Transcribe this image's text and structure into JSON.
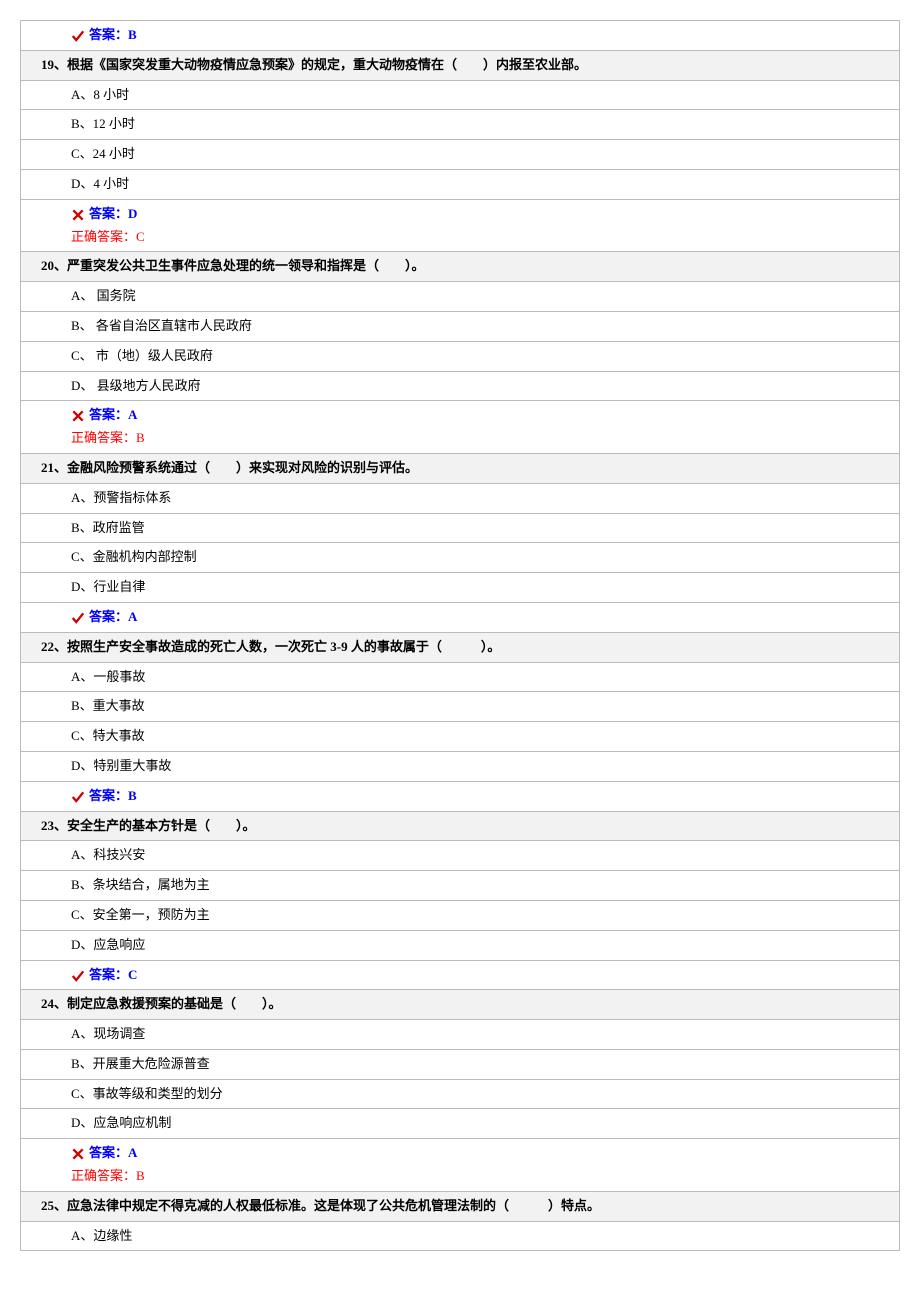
{
  "answer_prefix": "答案：",
  "correct_prefix": "正确答案：",
  "questions": [
    {
      "number": "",
      "text": "",
      "options": [],
      "user_answer": "B",
      "is_correct": true,
      "correct_answer": null
    },
    {
      "number": "19、",
      "text": "根据《国家突发重大动物疫情应急预案》的规定，重大动物疫情在（　　）内报至农业部。",
      "options": [
        "A、8 小时",
        "B、12 小时",
        "C、24 小时",
        "D、4 小时"
      ],
      "user_answer": "D",
      "is_correct": false,
      "correct_answer": "C"
    },
    {
      "number": "20、",
      "text": "严重突发公共卫生事件应急处理的统一领导和指挥是（　　）。",
      "options": [
        "A、 国务院",
        "B、 各省自治区直辖市人民政府",
        "C、 市（地）级人民政府",
        "D、 县级地方人民政府"
      ],
      "user_answer": "A",
      "is_correct": false,
      "correct_answer": "B"
    },
    {
      "number": "21、",
      "text": "金融风险预警系统通过（　　）来实现对风险的识别与评估。",
      "options": [
        "A、预警指标体系",
        "B、政府监管",
        "C、金融机构内部控制",
        "D、行业自律"
      ],
      "user_answer": "A",
      "is_correct": true,
      "correct_answer": null
    },
    {
      "number": "22、",
      "text": "按照生产安全事故造成的死亡人数，一次死亡 3-9 人的事故属于（　　　）。",
      "options": [
        "A、一般事故",
        "B、重大事故",
        "C、特大事故",
        "D、特别重大事故"
      ],
      "user_answer": "B",
      "is_correct": true,
      "correct_answer": null
    },
    {
      "number": "23、",
      "text": "安全生产的基本方针是（　　）。",
      "options": [
        "A、科技兴安",
        "B、条块结合，属地为主",
        "C、安全第一，预防为主",
        "D、应急响应"
      ],
      "user_answer": "C",
      "is_correct": true,
      "correct_answer": null
    },
    {
      "number": "24、",
      "text": "制定应急救援预案的基础是（　　）。",
      "options": [
        "A、现场调查",
        "B、开展重大危险源普查",
        "C、事故等级和类型的划分",
        "D、应急响应机制"
      ],
      "user_answer": "A",
      "is_correct": false,
      "correct_answer": "B"
    },
    {
      "number": "25、",
      "text": "应急法律中规定不得克减的人权最低标准。这是体现了公共危机管理法制的（　　　）特点。",
      "options": [
        "A、边缘性"
      ],
      "user_answer": null,
      "is_correct": null,
      "correct_answer": null
    }
  ]
}
